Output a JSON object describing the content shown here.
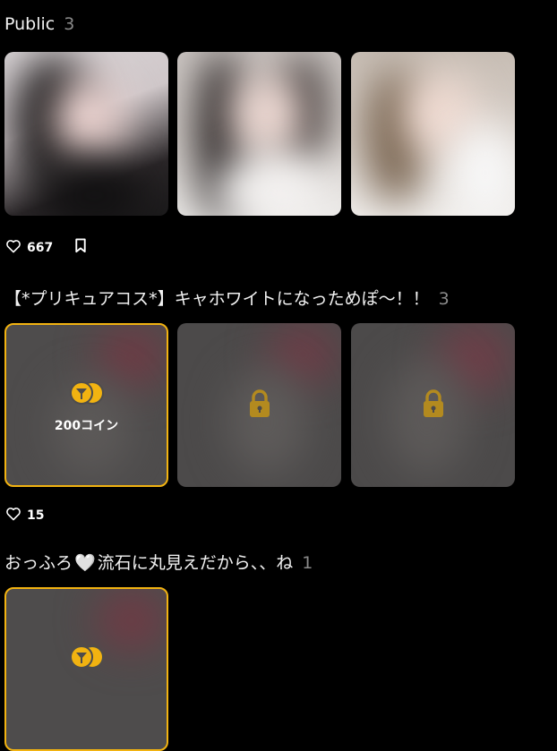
{
  "sections": [
    {
      "title": "Public",
      "count": "3",
      "likes": "667",
      "tiles": [
        {
          "kind": "photo",
          "icon": "portrait-photo"
        },
        {
          "kind": "photo",
          "icon": "portrait-photo"
        },
        {
          "kind": "photo",
          "icon": "portrait-photo"
        }
      ]
    },
    {
      "title": "【*プリキュアコス*】キャホワイトになっためぽ〜！！",
      "count": "3",
      "likes": "15",
      "coin_label": "200コイン",
      "tiles": [
        {
          "kind": "coin",
          "icon": "coin-icon"
        },
        {
          "kind": "locked",
          "icon": "lock-icon"
        },
        {
          "kind": "locked",
          "icon": "lock-icon"
        }
      ]
    },
    {
      "title": "おっふろ",
      "emoji": "🤍",
      "title_suffix": "流石に丸見えだから、、ね",
      "count": "1",
      "tiles": [
        {
          "kind": "coin",
          "icon": "coin-icon"
        }
      ]
    }
  ],
  "colors": {
    "accent": "#f2b311",
    "lock": "#b38a1f",
    "background": "#000000",
    "muted": "#8a8a8a"
  }
}
